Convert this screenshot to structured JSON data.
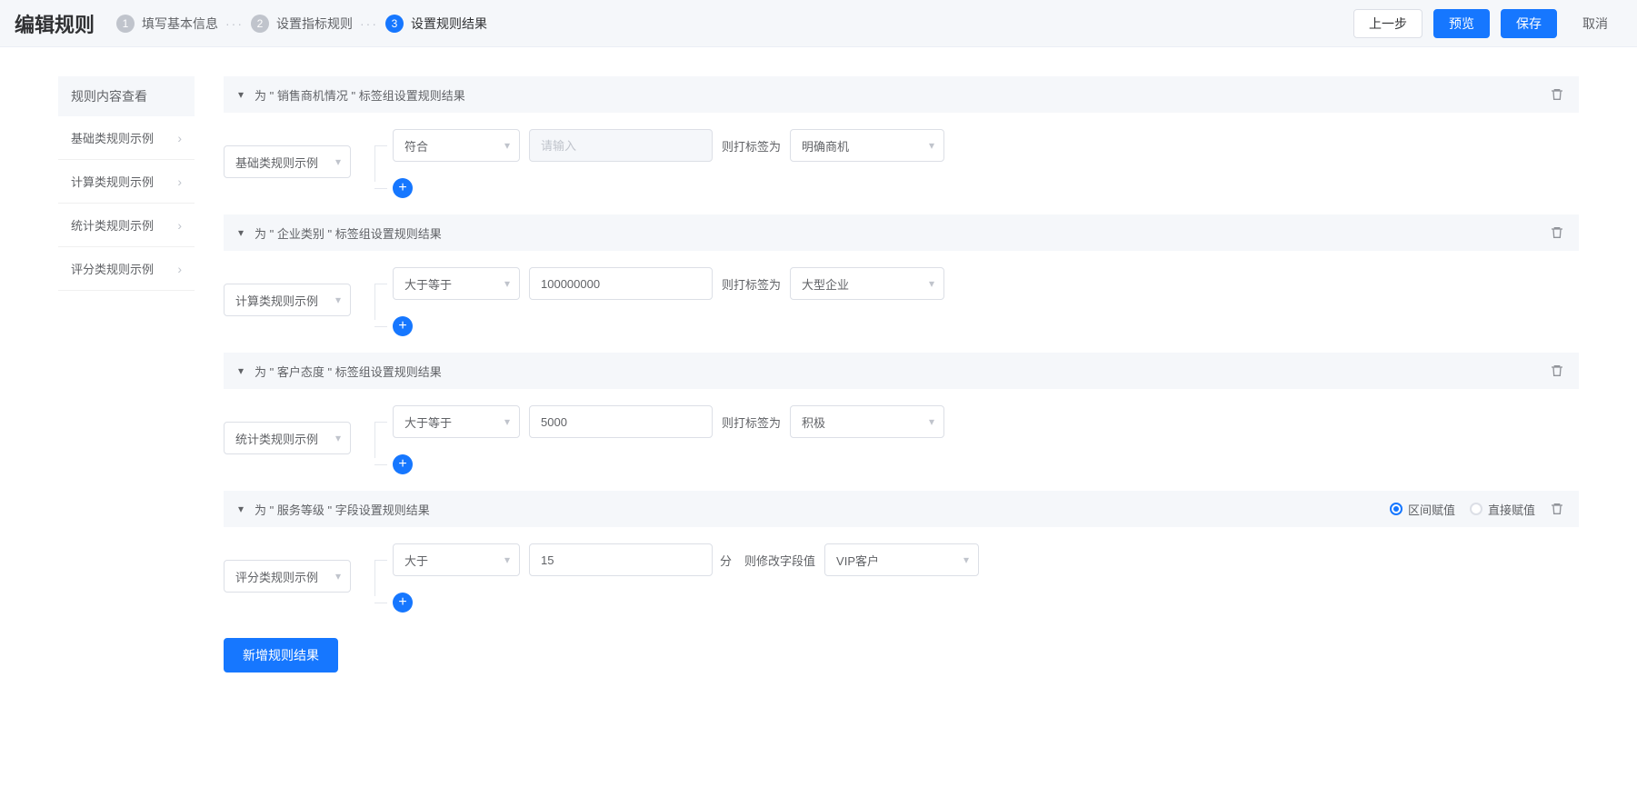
{
  "header": {
    "title": "编辑规则",
    "steps": [
      {
        "num": "1",
        "label": "填写基本信息",
        "state": "past"
      },
      {
        "num": "2",
        "label": "设置指标规则",
        "state": "past"
      },
      {
        "num": "3",
        "label": "设置规则结果",
        "state": "current"
      }
    ],
    "actions": {
      "prev": "上一步",
      "preview": "预览",
      "save": "保存",
      "cancel": "取消"
    }
  },
  "sidebar": {
    "header": "规则内容查看",
    "items": [
      {
        "label": "基础类规则示例"
      },
      {
        "label": "计算类规则示例"
      },
      {
        "label": "统计类规则示例"
      },
      {
        "label": "评分类规则示例"
      }
    ]
  },
  "sections": [
    {
      "id": "sec1",
      "header_prefix": "为 \" ",
      "header_tag": "销售商机情况",
      "header_suffix": " \" 标签组设置规则结果",
      "rule_type": "基础类规则示例",
      "condition_row": {
        "op": "符合",
        "value": "",
        "value_placeholder": "请输入",
        "value_disabled": true,
        "label": "则打标签为",
        "result": "明确商机",
        "result_type": "select"
      }
    },
    {
      "id": "sec2",
      "header_prefix": "为 \" ",
      "header_tag": "企业类别",
      "header_suffix": " \" 标签组设置规则结果",
      "rule_type": "计算类规则示例",
      "condition_row": {
        "op": "大于等于",
        "value": "100000000",
        "value_placeholder": "",
        "value_disabled": false,
        "label": "则打标签为",
        "result": "大型企业",
        "result_type": "select"
      }
    },
    {
      "id": "sec3",
      "header_prefix": "为 \" ",
      "header_tag": "客户态度",
      "header_suffix": " \" 标签组设置规则结果",
      "rule_type": "统计类规则示例",
      "condition_row": {
        "op": "大于等于",
        "value": "5000",
        "value_placeholder": "",
        "value_disabled": false,
        "label": "则打标签为",
        "result": "积极",
        "result_type": "select"
      }
    },
    {
      "id": "sec4",
      "header_prefix": "为 \" ",
      "header_tag": "服务等级",
      "header_suffix": " \" 字段设置规则结果",
      "rule_type": "评分类规则示例",
      "radios": {
        "interval": "区间赋值",
        "direct": "直接赋值",
        "selected": "interval"
      },
      "condition_row": {
        "op": "大于",
        "value": "15",
        "value_placeholder": "",
        "value_disabled": false,
        "unit": "分",
        "label": "则修改字段值",
        "result": "VIP客户",
        "result_type": "select"
      }
    }
  ],
  "add_button": "新增规则结果"
}
